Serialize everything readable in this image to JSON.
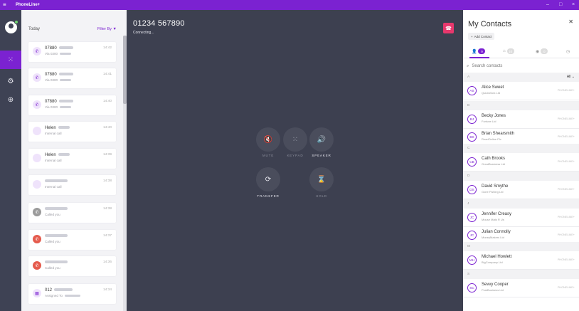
{
  "window": {
    "app_name": "PhoneLine+",
    "menu_icon": "hamburger-icon",
    "minimize": "–",
    "maximize": "□",
    "close": "×"
  },
  "rail": {
    "items": [
      {
        "icon": "dialpad-icon"
      },
      {
        "icon": "settings-icon"
      },
      {
        "icon": "globe-icon"
      }
    ]
  },
  "history": {
    "today_label": "Today",
    "filter_label": "Filter By",
    "items": [
      {
        "name": "07880",
        "sub": "Via 0300",
        "time": "14:42",
        "icon": "phone-icon",
        "style": "purple"
      },
      {
        "name": "07880",
        "sub": "Via 0300",
        "time": "14:41",
        "icon": "phone-icon",
        "style": "purple"
      },
      {
        "name": "07880",
        "sub": "Via 0300",
        "time": "14:40",
        "icon": "phone-icon",
        "style": "purple"
      },
      {
        "name": "Helen",
        "sub": "Internal call",
        "time": "14:40",
        "icon": "person-icon",
        "style": "purple"
      },
      {
        "name": "Helen",
        "sub": "Internal call",
        "time": "14:39",
        "icon": "person-icon",
        "style": "purple"
      },
      {
        "name": "",
        "sub": "Internal call",
        "time": "14:38",
        "icon": "person-icon",
        "style": "purple"
      },
      {
        "name": "",
        "sub": "Called you",
        "time": "14:38",
        "icon": "missed-call-icon",
        "style": "grey"
      },
      {
        "name": "",
        "sub": "Called you",
        "time": "14:37",
        "icon": "missed-call-icon",
        "style": "red"
      },
      {
        "name": "",
        "sub": "Called you",
        "time": "14:36",
        "icon": "missed-call-icon",
        "style": "red"
      },
      {
        "name": "012",
        "sub": "Assigned To",
        "time": "14:34",
        "icon": "assign-icon",
        "style": "purple"
      }
    ]
  },
  "call": {
    "number": "01234 567890",
    "status": "Connecting...",
    "controls": {
      "mute": "MUTE",
      "keypad": "KEYPAD",
      "speaker": "SPEAKER",
      "transfer": "TRANSFER",
      "hold": "HOLD"
    },
    "hangup_icon": "hangup-icon"
  },
  "contacts": {
    "title": "My Contacts",
    "add_label": "Add Contact",
    "tabs": [
      {
        "icon": "person-icon",
        "count": "9"
      },
      {
        "icon": "building-icon",
        "count": "10"
      },
      {
        "icon": "group-icon",
        "count": "0"
      },
      {
        "icon": "clock-icon",
        "count": ""
      }
    ],
    "search_placeholder": "Search contacts",
    "all_label": "All",
    "groups": [
      {
        "letter": "A",
        "contacts": [
          {
            "initials": "AS",
            "name": "Alice Sweet",
            "company": "QuickWork Ltd",
            "tag": "PHONELINE+"
          }
        ]
      },
      {
        "letter": "B",
        "contacts": [
          {
            "initials": "BJ",
            "name": "Becky Jones",
            "company": "Fortune Ltd",
            "tag": "PHONELINE+"
          },
          {
            "initials": "BS",
            "name": "Brian Shearsmith",
            "company": "ReadOnline Plc",
            "tag": "PHONELINE+"
          }
        ]
      },
      {
        "letter": "C",
        "contacts": [
          {
            "initials": "CB",
            "name": "Cath Brooks",
            "company": "GreatBusiness Ltd",
            "tag": "PHONELINE+"
          }
        ]
      },
      {
        "letter": "D",
        "contacts": [
          {
            "initials": "DS",
            "name": "David Smythe",
            "company": "Gone Fishing Ltd",
            "tag": "PHONELINE+"
          }
        ]
      },
      {
        "letter": "J",
        "contacts": [
          {
            "initials": "JC",
            "name": "Jennifer Creasy",
            "company": "Mouse Mats R Us",
            "tag": "PHONELINE+"
          },
          {
            "initials": "JC",
            "name": "Julian Connolly",
            "company": "MoneyMakers Ltd",
            "tag": "PHONELINE+"
          }
        ]
      },
      {
        "letter": "M",
        "contacts": [
          {
            "initials": "MH",
            "name": "Michael Howlett",
            "company": "BigCompany Ltd",
            "tag": "PHONELINE+"
          }
        ]
      },
      {
        "letter": "S",
        "contacts": [
          {
            "initials": "SC",
            "name": "Sevvy Cooper",
            "company": "PostBusiness Ltd",
            "tag": "PHONELINE+"
          }
        ]
      }
    ]
  },
  "colors": {
    "accent": "#7b22d1",
    "hangup": "#e8386d",
    "missed": "#e55b4d",
    "dark_bg": "#3d4050"
  }
}
